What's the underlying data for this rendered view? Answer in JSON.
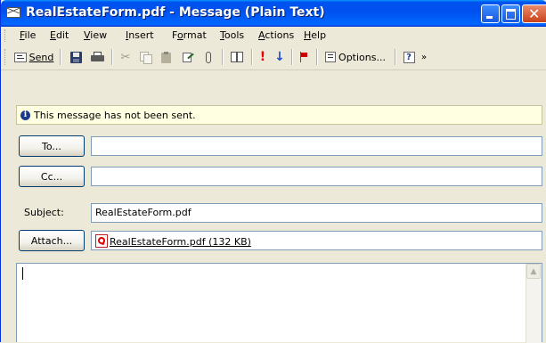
{
  "window": {
    "title": "RealEstateForm.pdf - Message (Plain Text)",
    "close_glyph": "✕"
  },
  "menu": [
    {
      "label": "File",
      "accel": "F"
    },
    {
      "label": "Edit",
      "accel": "E"
    },
    {
      "label": "View",
      "accel": "V"
    },
    {
      "label": "Insert",
      "accel": "I"
    },
    {
      "label": "Format",
      "accel": "o"
    },
    {
      "label": "Tools",
      "accel": "T"
    },
    {
      "label": "Actions",
      "accel": "A"
    },
    {
      "label": "Help",
      "accel": "H"
    }
  ],
  "toolbar": {
    "send_label": "Send",
    "options_label": "Options...",
    "icons": [
      "send-icon",
      "save-icon",
      "print-icon",
      "cut-icon",
      "copy-icon",
      "paste-icon",
      "signature-icon",
      "attach-icon",
      "address-book-icon",
      "importance-high-icon",
      "importance-low-icon",
      "flag-icon",
      "options-icon",
      "help-icon"
    ]
  },
  "infobar": {
    "text": "This message has not been sent."
  },
  "fields": {
    "to_button": "To...",
    "cc_button": "Cc...",
    "subject_label": "Subject:",
    "subject_value": "RealEstateForm.pdf",
    "attach_button": "Attach...",
    "attachment": "RealEstateForm.pdf (132 KB)"
  },
  "colors": {
    "titlebar": "#0053ee",
    "window_bg": "#ece9d8",
    "infobar_bg": "#ffffe1",
    "field_border": "#7f9db9"
  }
}
